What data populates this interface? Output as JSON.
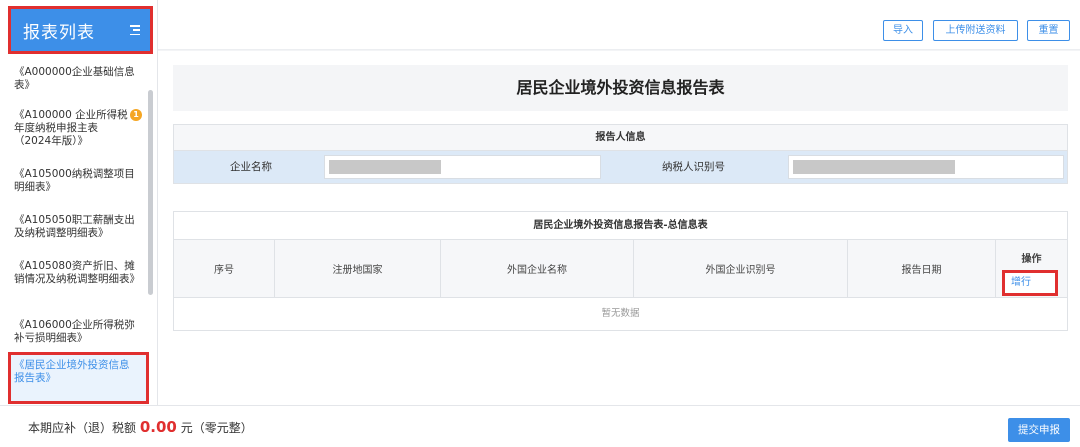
{
  "sidebar": {
    "title": "报表列表",
    "items": [
      {
        "label": "《A000000企业基础信息表》"
      },
      {
        "label": "《A100000 企业所得税年度纳税申报主表（2024年版）》",
        "badge": "1"
      },
      {
        "label": "《A105000纳税调整项目明细表》"
      },
      {
        "label": "《A105050职工薪酬支出及纳税调整明细表》"
      },
      {
        "label": "《A105080资产折旧、摊销情况及纳税调整明细表》"
      },
      {
        "label": "《A106000企业所得税弥补亏损明细表》"
      },
      {
        "label": "《居民企业境外投资信息报告表》",
        "active": true
      }
    ]
  },
  "toolbar": {
    "import_label": "导入",
    "upload_label": "上传附送资料",
    "reset_label": "重置"
  },
  "main": {
    "title": "居民企业境外投资信息报告表",
    "reporter": {
      "heading": "报告人信息",
      "company_label": "企业名称",
      "taxid_label": "纳税人识别号"
    },
    "summary": {
      "heading": "居民企业境外投资信息报告表-总信息表",
      "columns": [
        "序号",
        "注册地国家",
        "外国企业名称",
        "外国企业识别号",
        "报告日期",
        "操作"
      ],
      "add_row_label": "增行",
      "empty_text": "暂无数据"
    }
  },
  "footer": {
    "prefix": "本期应补（退）税额",
    "amount": "0.00",
    "suffix": "元（零元整）",
    "submit_label": "提交申报"
  },
  "colors": {
    "accent": "#3d8fe8",
    "highlight_border": "#e02f2f",
    "badge": "#f5a623"
  }
}
